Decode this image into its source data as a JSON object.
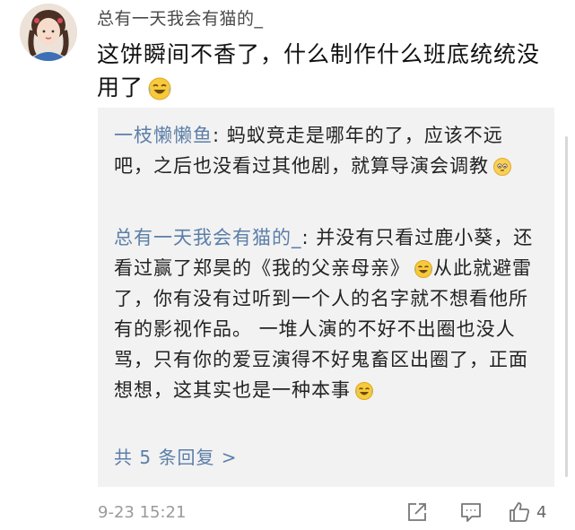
{
  "comment": {
    "username": "总有一天我会有猫的_",
    "text": "这饼瞬间不香了，什么制作什么班底统统没用了",
    "emoji": "laugh-cry-emoji"
  },
  "replies": [
    {
      "author": "一枝懒懒鱼",
      "text": ": 蚂蚁竞走是哪年的了，应该不远吧，之后也没看过其他剧，就算导演会调教",
      "emoji": "awkward-emoji"
    },
    {
      "author": "总有一天我会有猫的_",
      "text_part1": ": 并没有只看过鹿小葵，还看过赢了郑昊的《我的父亲母亲》",
      "text_part2": "从此就避雷了，你有没有过听到一个人的名字就不想看他所有的影视作品。 一堆人演的不好不出圈也没人骂，只有你的爱豆演得不好鬼畜区出圈了，正面想想，这其实也是一种本事",
      "emoji": "laugh-cry-emoji"
    }
  ],
  "more_replies_label": "共 5 条回复 >",
  "footer": {
    "timestamp": "9-23 15:21",
    "like_count": "4",
    "share_icon": "share-icon",
    "comment_icon": "comment-icon",
    "like_icon": "thumbs-up-icon"
  },
  "colors": {
    "link": "#5b7ea8",
    "reply_bg": "#f2f2f2",
    "muted": "#9a9a9a"
  }
}
